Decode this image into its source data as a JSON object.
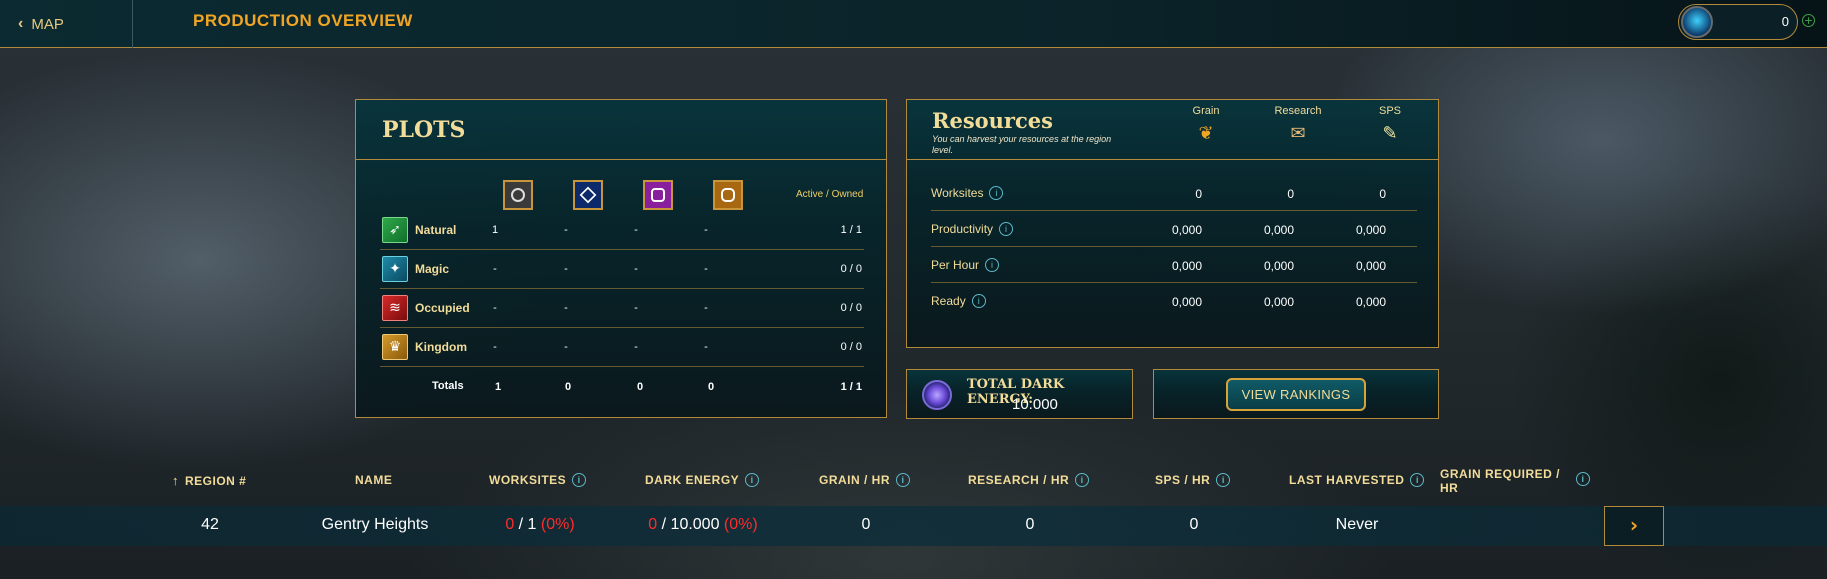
{
  "topbar": {
    "back_label": "MAP",
    "title": "PRODUCTION OVERVIEW",
    "wallet_value": "0"
  },
  "plots": {
    "title": "PLOTS",
    "active_owned_label": "Active / Owned",
    "rows": [
      {
        "label": "Natural",
        "cells": [
          "1",
          "-",
          "-",
          "-"
        ],
        "active_owned": "1 / 1"
      },
      {
        "label": "Magic",
        "cells": [
          "-",
          "-",
          "-",
          "-"
        ],
        "active_owned": "0 / 0"
      },
      {
        "label": "Occupied",
        "cells": [
          "-",
          "-",
          "-",
          "-"
        ],
        "active_owned": "0 / 0"
      },
      {
        "label": "Kingdom",
        "cells": [
          "-",
          "-",
          "-",
          "-"
        ],
        "active_owned": "0 / 0"
      }
    ],
    "totals": {
      "label": "Totals",
      "cells": [
        "1",
        "0",
        "0",
        "0"
      ],
      "active_owned": "1 / 1"
    }
  },
  "resources": {
    "title": "Resources",
    "subtitle": "You can harvest your resources at the region level.",
    "columns": [
      "Grain",
      "Research",
      "SPS"
    ],
    "rows": [
      {
        "label": "Worksites",
        "values": [
          "0",
          "0",
          "0"
        ]
      },
      {
        "label": "Productivity",
        "values": [
          "0,000",
          "0,000",
          "0,000"
        ]
      },
      {
        "label": "Per Hour",
        "values": [
          "0,000",
          "0,000",
          "0,000"
        ]
      },
      {
        "label": "Ready",
        "values": [
          "0,000",
          "0,000",
          "0,000"
        ]
      }
    ]
  },
  "dark_energy": {
    "label": "TOTAL DARK ENERGY:",
    "value": "10.000"
  },
  "rankings": {
    "button_label": "VIEW RANKINGS"
  },
  "table": {
    "headers": [
      "REGION #",
      "NAME",
      "WORKSITES",
      "DARK ENERGY",
      "GRAIN / HR",
      "RESEARCH / HR",
      "SPS / HR",
      "LAST HARVESTED",
      "GRAIN REQUIRED / HR"
    ],
    "row": {
      "region": "42",
      "name": "Gentry Heights",
      "worksites_active": "0",
      "worksites_total": " / 1 ",
      "worksites_pct": "(0%)",
      "energy_active": "0",
      "energy_total": " / 10.000 ",
      "energy_pct": "(0%)",
      "grain_hr": "0",
      "research_hr": "0",
      "sps_hr": "0",
      "last_harvested": "Never"
    }
  },
  "colors": {
    "accent_gold": "#f0a525",
    "border_gold": "#b38a3a",
    "negative_red": "#ff2b2b"
  },
  "icons": {
    "back": "chevron-left-icon",
    "wallet": "crystal-gem-icon",
    "add": "plus-icon",
    "natural": "leaf-icon",
    "magic": "sparkle-icon",
    "occupied": "claw-icon",
    "kingdom": "crown-icon",
    "grain": "wheat-icon",
    "research": "scroll-icon",
    "sps": "quill-icon",
    "energy": "dark-energy-orb-icon",
    "sort": "sort-arrow-icon",
    "info": "info-icon",
    "go": "chevron-right-icon"
  }
}
